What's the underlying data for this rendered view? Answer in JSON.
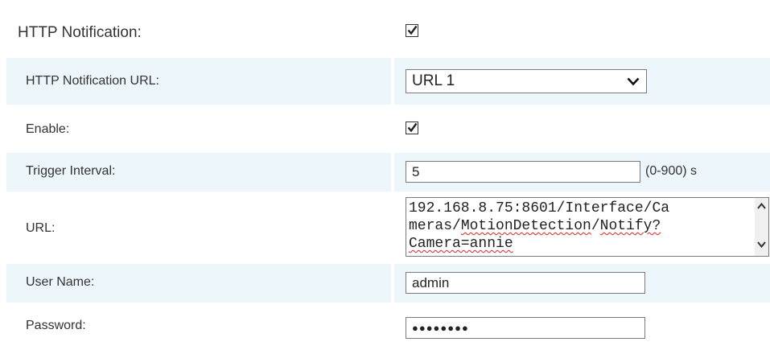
{
  "http_notification": {
    "label": "HTTP Notification:",
    "checked": true
  },
  "http_notification_url": {
    "label": "HTTP Notification URL:",
    "selected": "URL 1"
  },
  "enable": {
    "label": "Enable:",
    "checked": true
  },
  "trigger_interval": {
    "label": "Trigger Interval:",
    "value": "5",
    "unit": "(0-900) s"
  },
  "url": {
    "label": "URL:",
    "line1": "192.168.8.75:8601/Interface/Ca",
    "line2_a": "meras/",
    "line2_b": "MotionDetection",
    "line2_c": "/",
    "line2_d": "Notify?",
    "line3": "Camera=annie"
  },
  "user_name": {
    "label": "User Name:",
    "value": "admin"
  },
  "password": {
    "label": "Password:",
    "value": "●●●●●●●●"
  },
  "icons": {
    "checkbox": "checkmark-icon",
    "dropdown": "chevron-down-icon",
    "scroll_up": "scroll-up-icon",
    "scroll_down": "scroll-down-icon"
  }
}
